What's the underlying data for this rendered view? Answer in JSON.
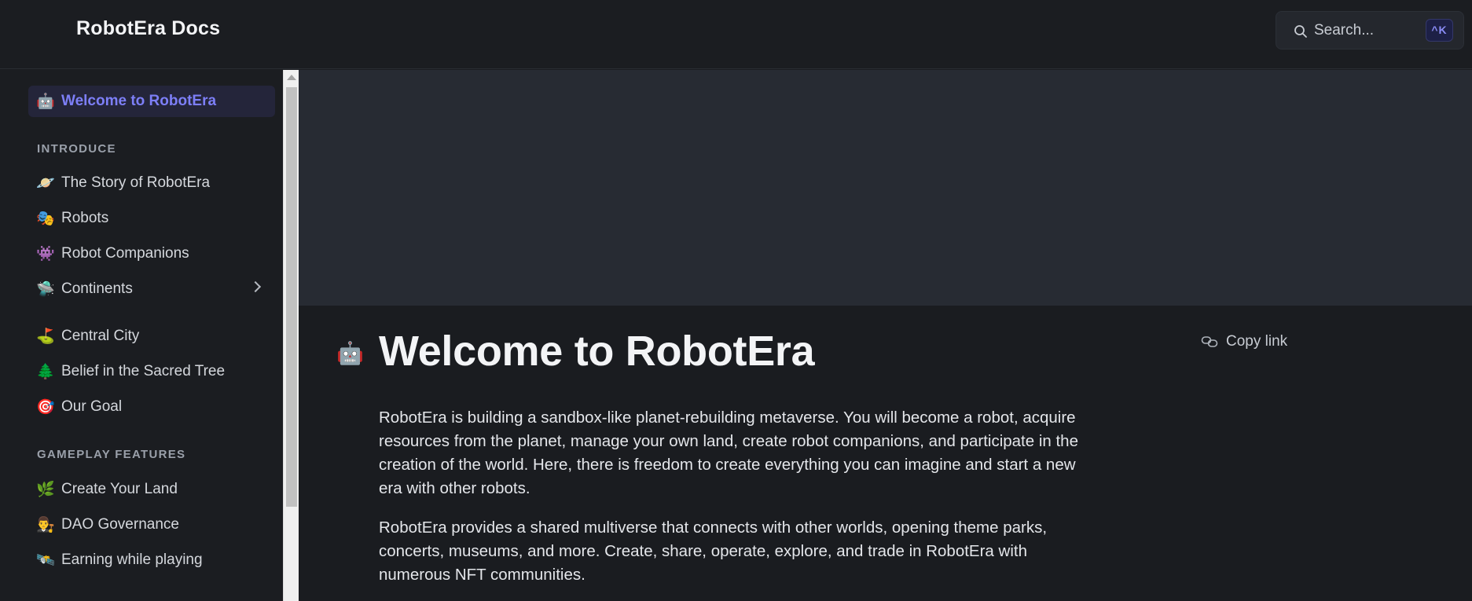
{
  "header": {
    "brand": "RobotEra Docs",
    "search_placeholder": "Search...",
    "search_shortcut": "^K"
  },
  "sidebar": {
    "active_item": {
      "emoji": "🤖",
      "label": "Welcome to RobotEra"
    },
    "sections": [
      {
        "title": "INTRODUCE",
        "items": [
          {
            "emoji": "🪐",
            "label": "The Story of RobotEra"
          },
          {
            "emoji": "🎭",
            "label": "Robots"
          },
          {
            "emoji": "👾",
            "label": "Robot Companions"
          },
          {
            "emoji": "🛸",
            "label": "Continents"
          },
          {
            "emoji": "⛳",
            "label": "Central City"
          },
          {
            "emoji": "🌲",
            "label": "Belief in the Sacred Tree"
          },
          {
            "emoji": "🎯",
            "label": "Our Goal"
          }
        ]
      },
      {
        "title": "GAMEPLAY FEATURES",
        "items": [
          {
            "emoji": "🌿",
            "label": "Create Your Land"
          },
          {
            "emoji": "👨‍⚖️",
            "label": "DAO Governance"
          },
          {
            "emoji": "🛰️",
            "label": "Earning while playing"
          }
        ]
      }
    ]
  },
  "main": {
    "title_emoji": "🤖",
    "title": "Welcome to RobotEra",
    "copy_link": "Copy link",
    "paragraphs": [
      "RobotEra is building a sandbox-like planet-rebuilding metaverse. You will become a robot, acquire resources from the planet, manage your own land, create robot companions, and participate in the creation of the world. Here, there is freedom to create everything you can imagine and start a new era with other robots.",
      "RobotEra provides a shared multiverse that connects with other worlds, opening theme parks, concerts, museums, and more. Create, share, operate, explore, and trade in RobotEra with numerous NFT communities."
    ]
  },
  "colors": {
    "accent": "#7d7ff7",
    "background": "#1a1c20",
    "hero": "#272b33"
  }
}
